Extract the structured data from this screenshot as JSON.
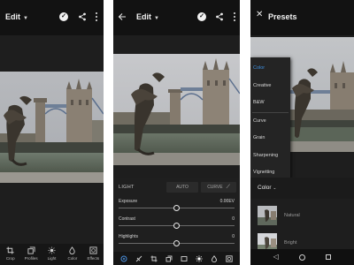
{
  "screen1": {
    "title": "Edit",
    "toolbar": [
      {
        "label": "Crop",
        "icon": "crop-icon"
      },
      {
        "label": "Profiles",
        "icon": "profiles-icon"
      },
      {
        "label": "Light",
        "icon": "light-icon"
      },
      {
        "label": "Color",
        "icon": "color-icon"
      },
      {
        "label": "Effects",
        "icon": "effects-icon"
      }
    ]
  },
  "screen2": {
    "title": "Edit",
    "panel": {
      "title": "LIGHT",
      "auto_label": "AUTO",
      "curve_label": "CURVE",
      "sliders": [
        {
          "label": "Exposure",
          "value": "0.00EV",
          "level": 0.5
        },
        {
          "label": "Contrast",
          "value": "0",
          "level": 0.5
        },
        {
          "label": "Highlights",
          "value": "0",
          "level": 0.5
        }
      ]
    }
  },
  "screen3": {
    "title": "Presets",
    "category": "Color",
    "menu": [
      "Color",
      "Creative",
      "B&W",
      "Curve",
      "Grain",
      "Sharpening",
      "Vignetting"
    ],
    "menu_selected": "Color",
    "presets": [
      "Natural",
      "Bright"
    ]
  },
  "colors": {
    "accent": "#3d8fe0",
    "background": "#1e1e1e",
    "topbar": "#121212"
  }
}
